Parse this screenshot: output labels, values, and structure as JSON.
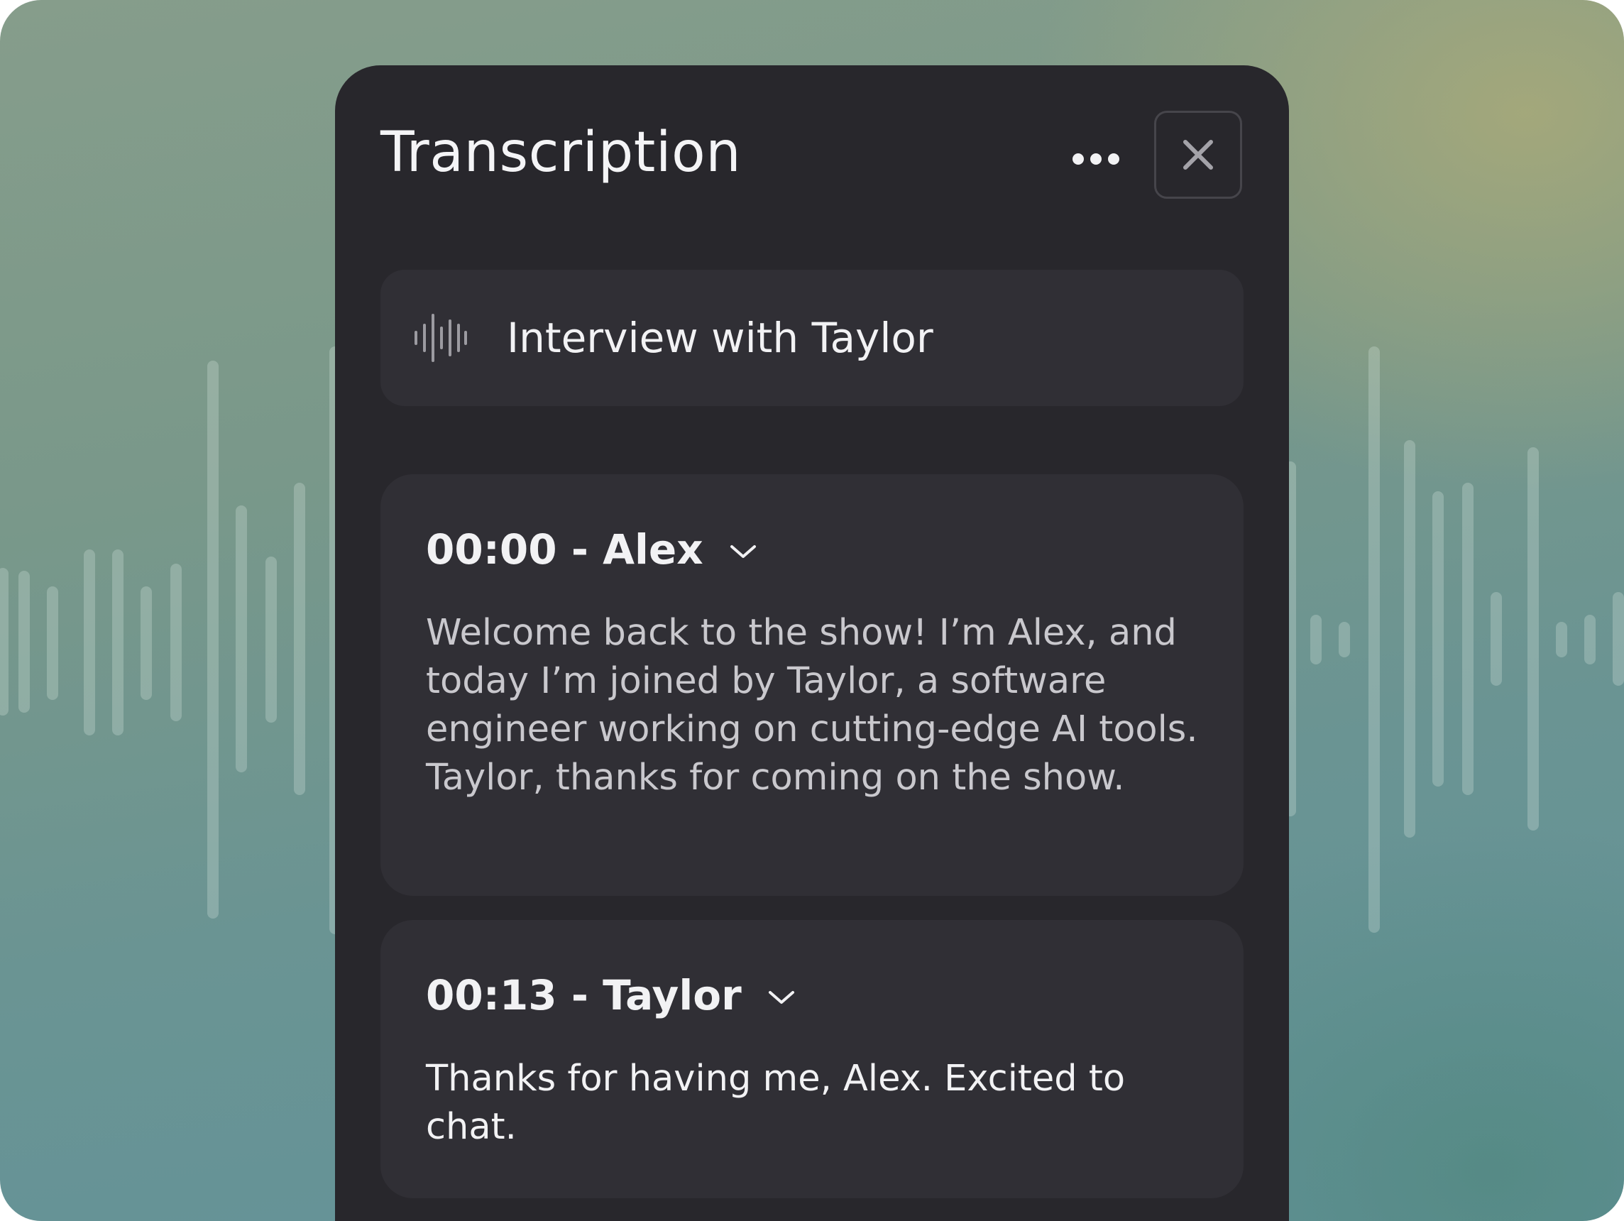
{
  "panel": {
    "title": "Transcription",
    "more_icon": "more-horizontal-icon",
    "close_icon": "close-icon"
  },
  "file": {
    "icon": "waveform-icon",
    "name": "Interview with Taylor"
  },
  "segments": [
    {
      "time": "00:00",
      "separator": " - ",
      "speaker": "Alex",
      "text": "Welcome back to the show! I’m Alex, and today I’m joined by Taylor, a software engineer working on cutting-edge AI tools. Taylor, thanks for coming on the show.",
      "text_color": "#c9c8cd"
    },
    {
      "time": "00:13",
      "separator": " - ",
      "speaker": "Taylor",
      "text": "Thanks for having me, Alex. Excited to chat.",
      "text_color": "#f2f2f4"
    }
  ],
  "colors": {
    "panel_bg": "#28272c",
    "card_bg": "#302f35",
    "text_primary": "#f2f2f4"
  }
}
